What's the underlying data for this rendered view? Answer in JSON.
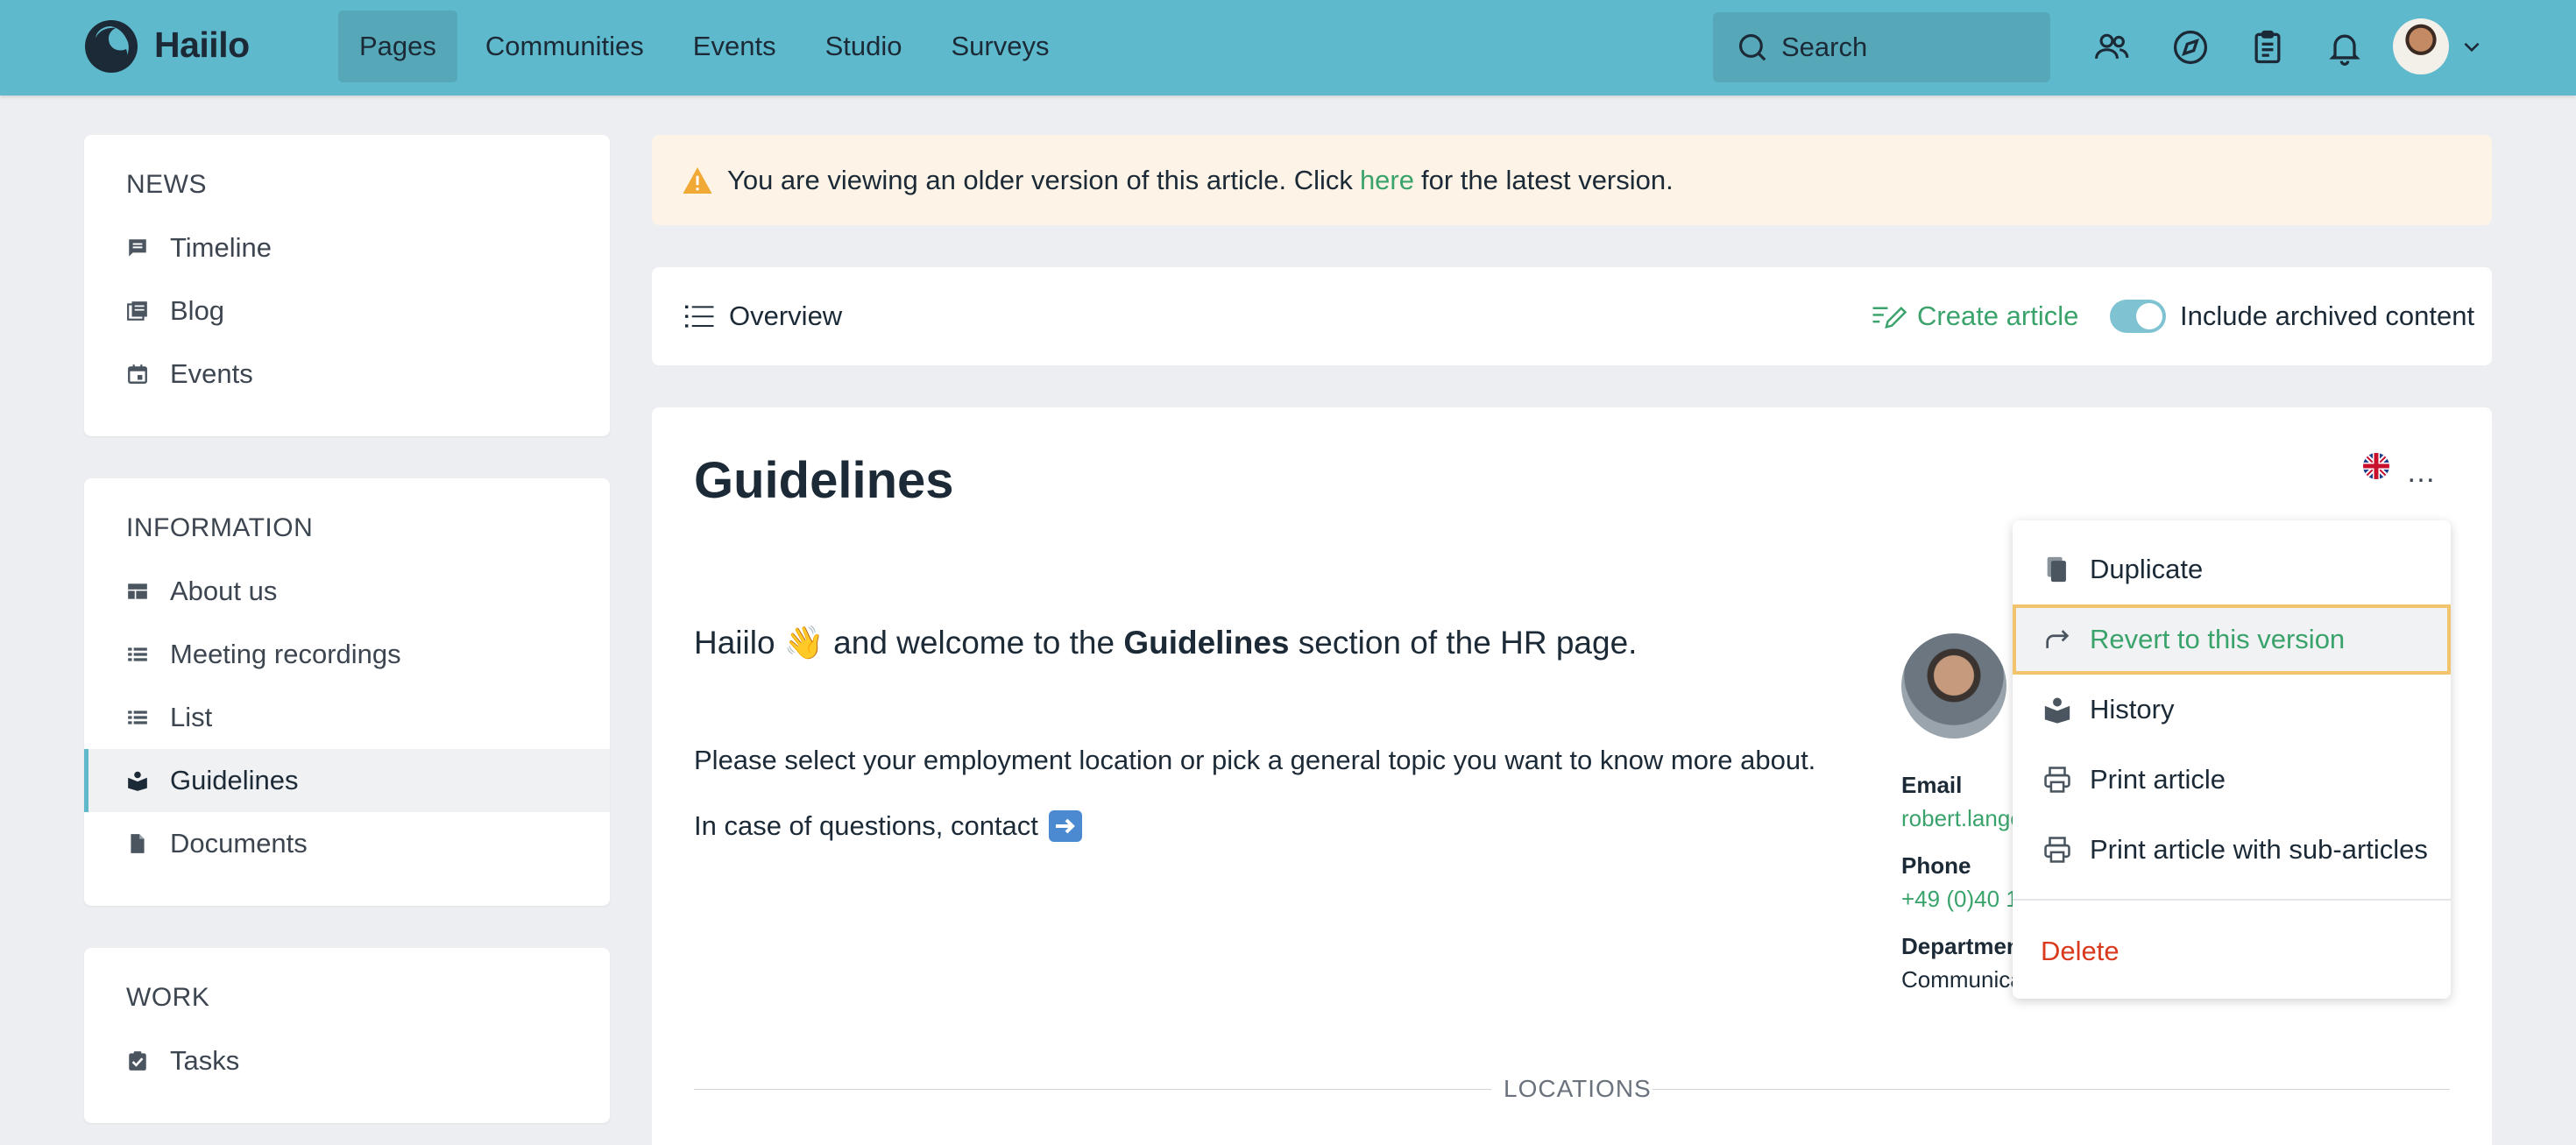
{
  "app": {
    "brand": "Haiilo"
  },
  "nav": {
    "items": [
      {
        "label": "Pages",
        "active": true
      },
      {
        "label": "Communities",
        "active": false
      },
      {
        "label": "Events",
        "active": false
      },
      {
        "label": "Studio",
        "active": false
      },
      {
        "label": "Surveys",
        "active": false
      }
    ]
  },
  "search": {
    "placeholder": "Search"
  },
  "sidebar": {
    "news": {
      "title": "NEWS",
      "items": [
        {
          "label": "Timeline",
          "icon": "timeline-icon"
        },
        {
          "label": "Blog",
          "icon": "blog-icon"
        },
        {
          "label": "Events",
          "icon": "calendar-icon"
        }
      ]
    },
    "information": {
      "title": "INFORMATION",
      "items": [
        {
          "label": "About us",
          "icon": "table-icon"
        },
        {
          "label": "Meeting recordings",
          "icon": "list-icon"
        },
        {
          "label": "List",
          "icon": "list-icon"
        },
        {
          "label": "Guidelines",
          "icon": "book-icon",
          "active": true
        },
        {
          "label": "Documents",
          "icon": "document-icon"
        }
      ]
    },
    "work": {
      "title": "WORK",
      "items": [
        {
          "label": "Tasks",
          "icon": "task-icon"
        }
      ]
    }
  },
  "alert": {
    "text_before": "You are viewing an older version of this article. Click",
    "link": "here",
    "text_after": "for the latest version."
  },
  "toolbar": {
    "overview": "Overview",
    "create_article": "Create article",
    "include_archived": "Include archived content",
    "include_archived_on": true
  },
  "article": {
    "title": "Guidelines",
    "intro_before": "Haiilo 👋 and welcome to the",
    "intro_bold": "Guidelines",
    "intro_after": "section of the HR page.",
    "paragraph1": "Please select your employment location or pick a general topic you want to know more about.",
    "paragraph2": "In case of questions, contact",
    "section_label": "LOCATIONS"
  },
  "contact": {
    "email_label": "Email",
    "email_value": "robert.lange",
    "phone_label": "Phone",
    "phone_value": "+49 (0)40 1",
    "department_label": "Departmen",
    "department_value": "Communica"
  },
  "menu": {
    "items": [
      {
        "label": "Duplicate",
        "icon": "copy-icon"
      },
      {
        "label": "Revert to this version",
        "icon": "revert-icon",
        "highlighted": true
      },
      {
        "label": "History",
        "icon": "history-icon"
      },
      {
        "label": "Print article",
        "icon": "printer-icon"
      },
      {
        "label": "Print article with sub-articles",
        "icon": "printer-icon"
      }
    ],
    "delete": "Delete"
  },
  "colors": {
    "topbar": "#5fb9cc",
    "accent_green": "#3aa36b",
    "danger": "#d9391c",
    "alert_bg": "#fdf3e6",
    "highlight_border": "#f3c46e"
  }
}
